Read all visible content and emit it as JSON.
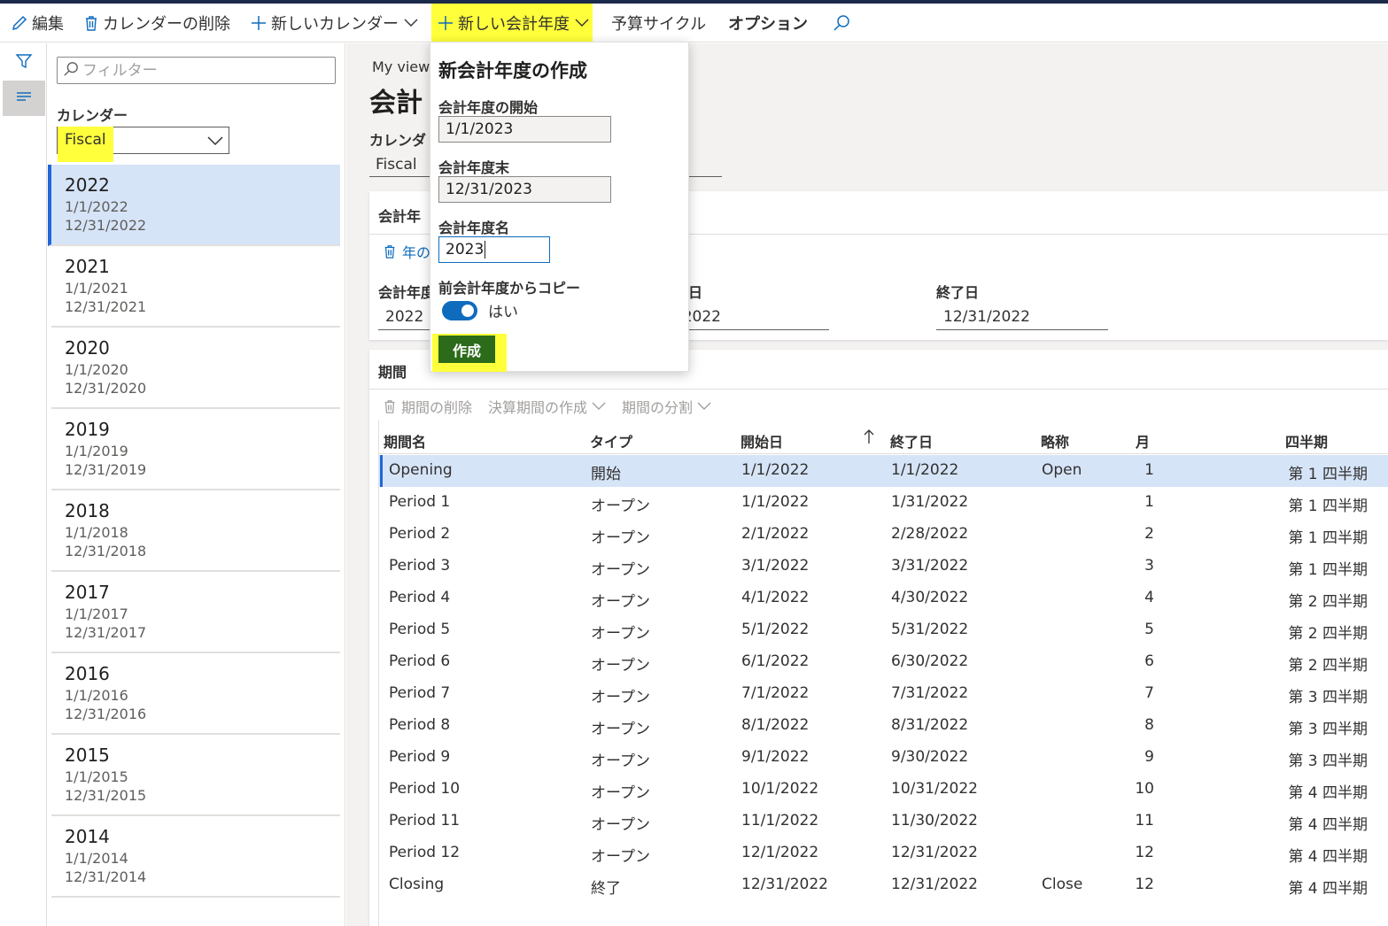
{
  "toolbar": {
    "edit": "編集",
    "delete_calendar": "カレンダーの削除",
    "new_calendar": "新しいカレンダー",
    "new_fiscal_year": "新しい会計年度",
    "budget_cycle": "予算サイクル",
    "options": "オプション",
    "highlight_color": "#ffff3b",
    "accent_color": "#0f6cbd"
  },
  "list": {
    "filter_placeholder": "フィルター",
    "calendar_label": "カレンダー",
    "calendar_value": "Fiscal",
    "years": [
      {
        "year": "2022",
        "start": "1/1/2022",
        "end": "12/31/2022",
        "selected": true
      },
      {
        "year": "2021",
        "start": "1/1/2021",
        "end": "12/31/2021"
      },
      {
        "year": "2020",
        "start": "1/1/2020",
        "end": "12/31/2020"
      },
      {
        "year": "2019",
        "start": "1/1/2019",
        "end": "12/31/2019"
      },
      {
        "year": "2018",
        "start": "1/1/2018",
        "end": "12/31/2018"
      },
      {
        "year": "2017",
        "start": "1/1/2017",
        "end": "12/31/2017"
      },
      {
        "year": "2016",
        "start": "1/1/2016",
        "end": "12/31/2016"
      },
      {
        "year": "2015",
        "start": "1/1/2015",
        "end": "12/31/2015"
      },
      {
        "year": "2014",
        "start": "1/1/2014",
        "end": "12/31/2014"
      }
    ]
  },
  "main": {
    "breadcrumb": "My view",
    "title": "会計",
    "calendar_label": "カレンダ",
    "calendar_value": "Fiscal",
    "fiscal_year_card": {
      "title": "会計年",
      "delete_action": "年の",
      "field_year_label": "会計年度",
      "field_year_value": "2022",
      "field_start_label": "日",
      "field_start_value": "/2022",
      "field_end_label": "終了日",
      "field_end_value": "12/31/2022"
    },
    "periods_card": {
      "title": "期間",
      "actions": [
        "期間の削除",
        "決算期間の作成",
        "期間の分割"
      ],
      "columns": [
        "期間名",
        "タイプ",
        "開始日",
        "終了日",
        "略称",
        "月",
        "四半期"
      ],
      "rows": [
        {
          "name": "Opening",
          "type": "開始",
          "start": "1/1/2022",
          "end": "1/1/2022",
          "short": "Open",
          "month": "1",
          "quarter": "第 1 四半期",
          "selected": true
        },
        {
          "name": "Period 1",
          "type": "オープン",
          "start": "1/1/2022",
          "end": "1/31/2022",
          "short": "",
          "month": "1",
          "quarter": "第 1 四半期"
        },
        {
          "name": "Period 2",
          "type": "オープン",
          "start": "2/1/2022",
          "end": "2/28/2022",
          "short": "",
          "month": "2",
          "quarter": "第 1 四半期"
        },
        {
          "name": "Period 3",
          "type": "オープン",
          "start": "3/1/2022",
          "end": "3/31/2022",
          "short": "",
          "month": "3",
          "quarter": "第 1 四半期"
        },
        {
          "name": "Period 4",
          "type": "オープン",
          "start": "4/1/2022",
          "end": "4/30/2022",
          "short": "",
          "month": "4",
          "quarter": "第 2 四半期"
        },
        {
          "name": "Period 5",
          "type": "オープン",
          "start": "5/1/2022",
          "end": "5/31/2022",
          "short": "",
          "month": "5",
          "quarter": "第 2 四半期"
        },
        {
          "name": "Period 6",
          "type": "オープン",
          "start": "6/1/2022",
          "end": "6/30/2022",
          "short": "",
          "month": "6",
          "quarter": "第 2 四半期"
        },
        {
          "name": "Period 7",
          "type": "オープン",
          "start": "7/1/2022",
          "end": "7/31/2022",
          "short": "",
          "month": "7",
          "quarter": "第 3 四半期"
        },
        {
          "name": "Period 8",
          "type": "オープン",
          "start": "8/1/2022",
          "end": "8/31/2022",
          "short": "",
          "month": "8",
          "quarter": "第 3 四半期"
        },
        {
          "name": "Period 9",
          "type": "オープン",
          "start": "9/1/2022",
          "end": "9/30/2022",
          "short": "",
          "month": "9",
          "quarter": "第 3 四半期"
        },
        {
          "name": "Period 10",
          "type": "オープン",
          "start": "10/1/2022",
          "end": "10/31/2022",
          "short": "",
          "month": "10",
          "quarter": "第 4 四半期"
        },
        {
          "name": "Period 11",
          "type": "オープン",
          "start": "11/1/2022",
          "end": "11/30/2022",
          "short": "",
          "month": "11",
          "quarter": "第 4 四半期"
        },
        {
          "name": "Period 12",
          "type": "オープン",
          "start": "12/1/2022",
          "end": "12/31/2022",
          "short": "",
          "month": "12",
          "quarter": "第 4 四半期"
        },
        {
          "name": "Closing",
          "type": "終了",
          "start": "12/31/2022",
          "end": "12/31/2022",
          "short": "Close",
          "month": "12",
          "quarter": "第 4 四半期"
        }
      ]
    }
  },
  "popup": {
    "title": "新会計年度の作成",
    "start_label": "会計年度の開始",
    "start_value": "1/1/2023",
    "end_label": "会計年度末",
    "end_value": "12/31/2023",
    "name_label": "会計年度名",
    "name_value": "2023",
    "copy_label": "前会計年度からコピー",
    "copy_toggle_text": "はい",
    "copy_enabled": true,
    "create_button": "作成",
    "create_button_color": "#2b6b1a"
  }
}
